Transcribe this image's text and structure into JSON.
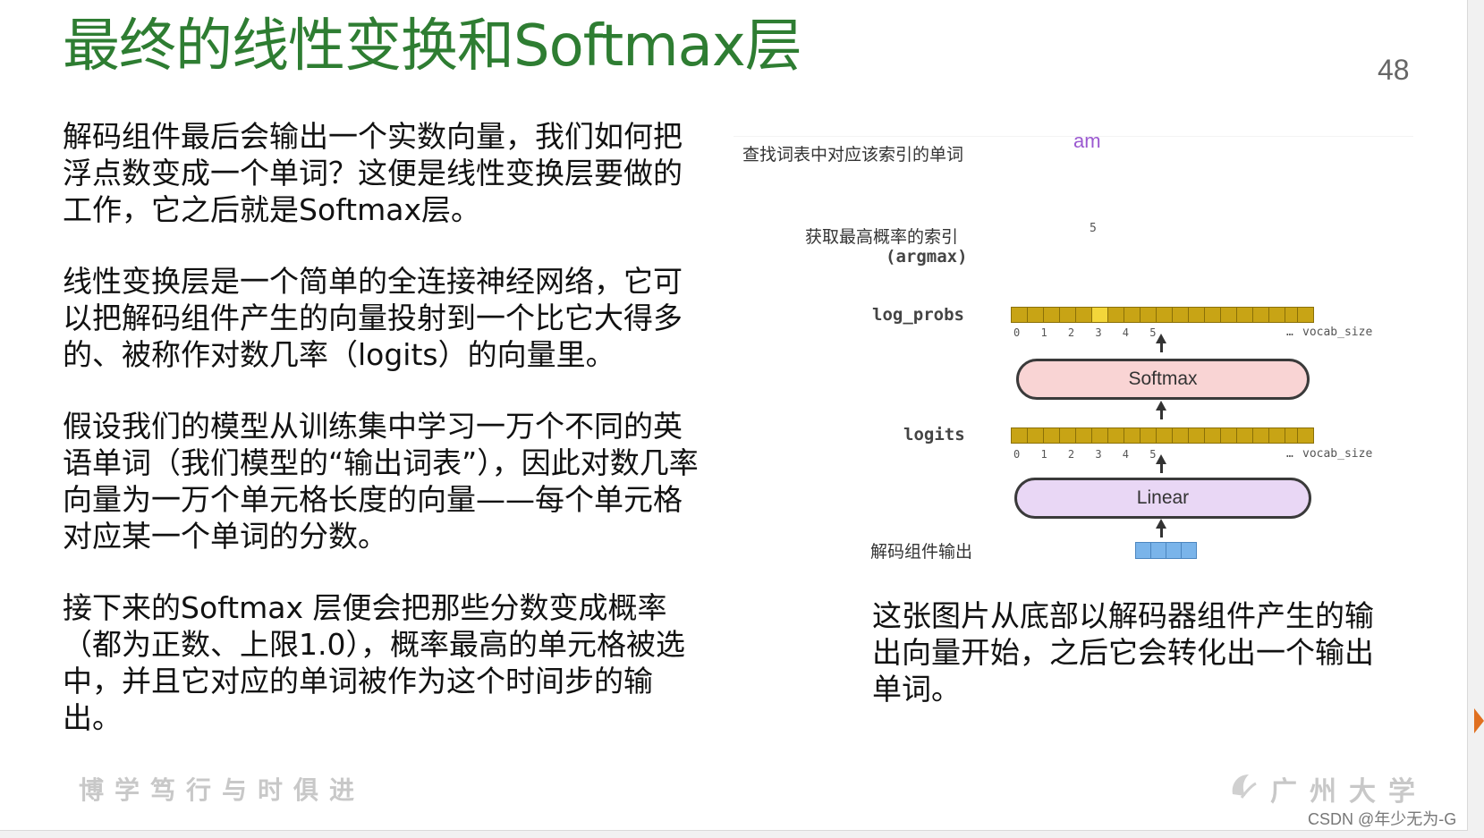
{
  "slide": {
    "title": "最终的线性变换和Softmax层",
    "page_number": "48"
  },
  "body": {
    "paragraphs": [
      "解码组件最后会输出一个实数向量，我们如何把浮点数变成一个单词？这便是线性变换层要做的工作，它之后就是Softmax层。",
      "线性变换层是一个简单的全连接神经网络，它可以把解码组件产生的向量投射到一个比它大得多的、被称作对数几率（logits）的向量里。",
      "假设我们的模型从训练集中学习一万个不同的英语单词（我们模型的“输出词表”），因此对数几率向量为一万个单元格长度的向量——每个单元格对应某一个单词的分数。",
      "接下来的Softmax 层便会把那些分数变成概率（都为正数、上限1.0），概率最高的单元格被选中，并且它对应的单词被作为这个时间步的输出。"
    ]
  },
  "diagram": {
    "lookup_label": "查找词表中对应该索引的单词",
    "output_word": "am",
    "argmax_label": "获取最高概率的索引",
    "argmax_code": "(argmax)",
    "argmax_value": "5",
    "log_probs_label": "log_probs",
    "logits_label": "logits",
    "decoder_output_label": "解码组件输出",
    "softmax_label": "Softmax",
    "linear_label": "Linear",
    "index_ticks": "0 1 2 3 4 5",
    "ellipsis": "…",
    "vocab_size_label": "vocab_size",
    "highlight_index": 5,
    "colors": {
      "cell": "#c8a415",
      "cell_highlight": "#f3d63a",
      "softmax_fill": "#f9d4d4",
      "linear_fill": "#e9d7f5",
      "decoder_cell": "#7ab4ea",
      "word": "#9b59d0"
    }
  },
  "caption": "这张图片从底部以解码器组件产生的输出向量开始，之后它会转化出一个输出单词。",
  "footer": {
    "motto": "博学笃行与时俱进",
    "university": "广州大学",
    "watermark": "CSDN @年少无为-G"
  },
  "theme": {
    "title_color": "#2e7d32"
  }
}
